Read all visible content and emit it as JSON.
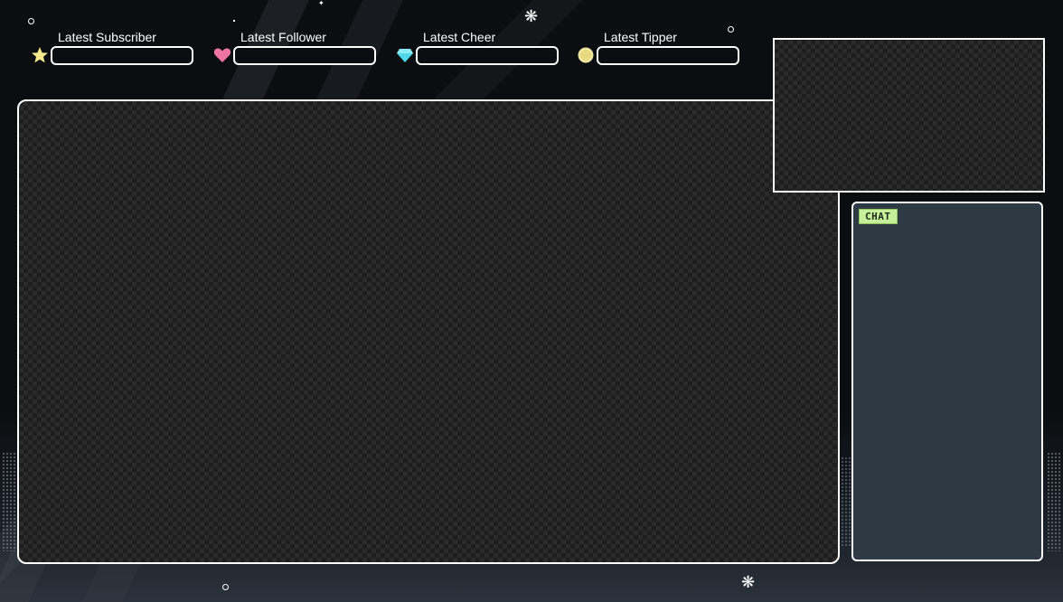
{
  "overlay": {
    "alerts": [
      {
        "label": "Latest Subscriber",
        "icon": "star-icon",
        "color": "#f4e98a"
      },
      {
        "label": "Latest Follower",
        "icon": "heart-icon",
        "color": "#ee74a6"
      },
      {
        "label": "Latest Cheer",
        "icon": "gem-icon",
        "color": "#4ed8e8"
      },
      {
        "label": "Latest Tipper",
        "icon": "coin-icon",
        "color": "#f2e7a0"
      }
    ],
    "chat": {
      "tag_label": "CHAT",
      "tag_color": "#c6f09a",
      "panel_color": "#2d3a44"
    },
    "colors": {
      "background": "#0b0d10",
      "border": "#ffffff"
    }
  }
}
